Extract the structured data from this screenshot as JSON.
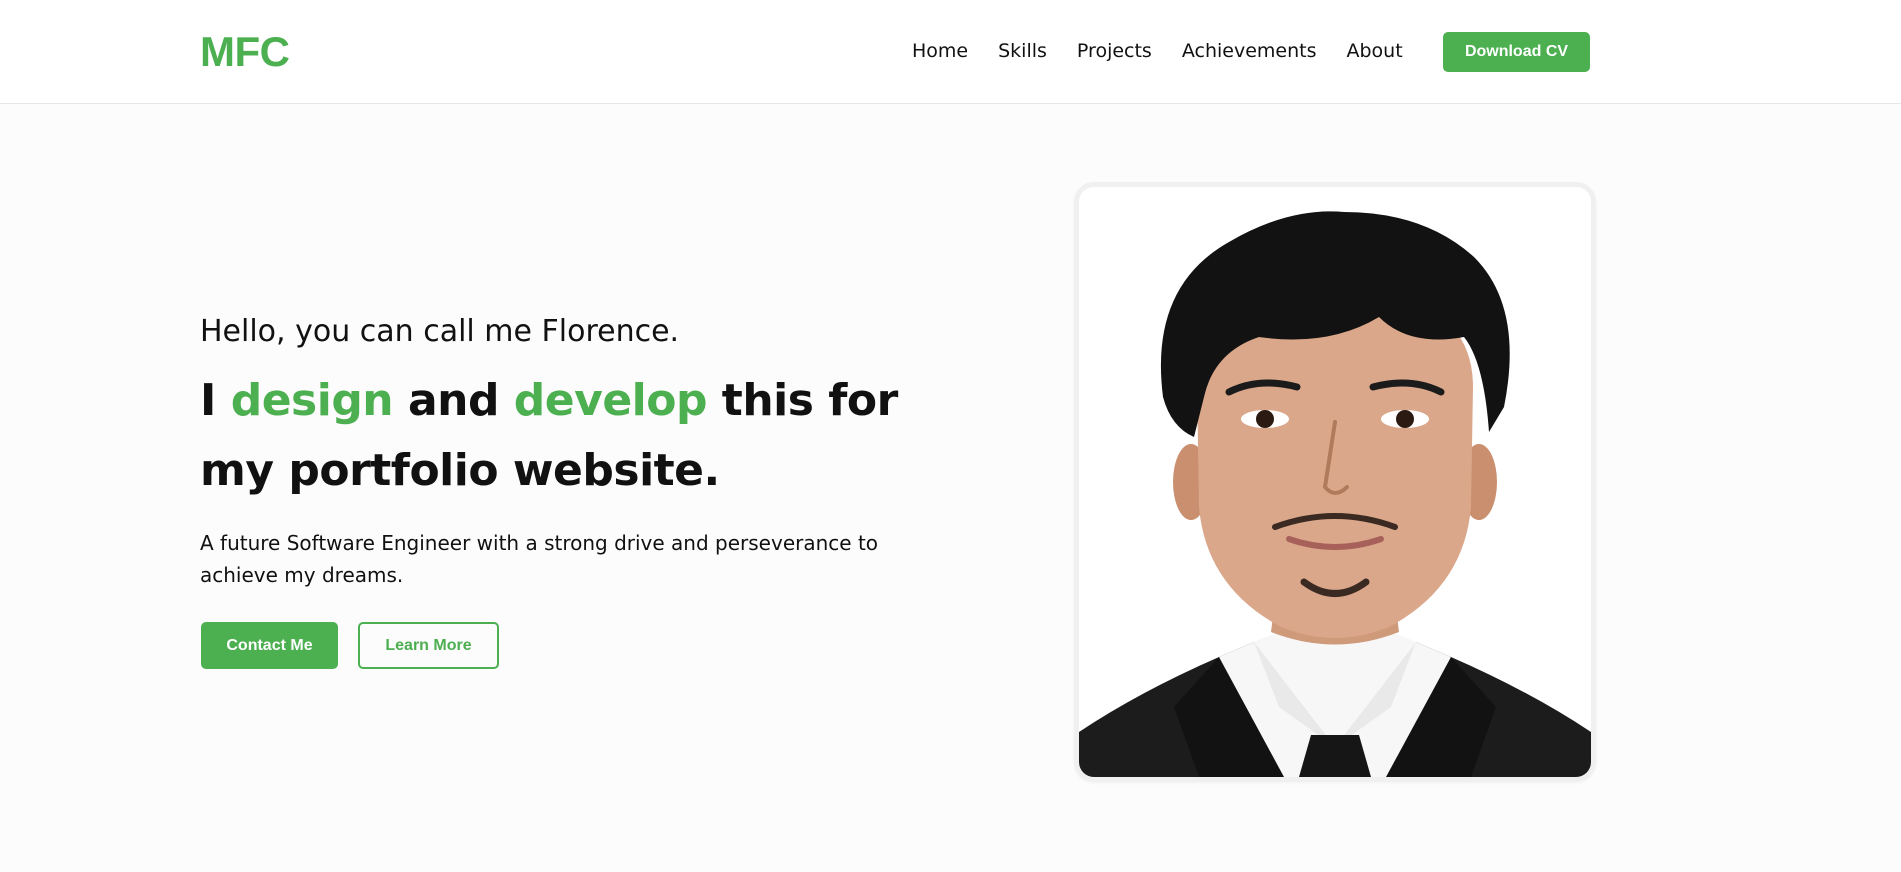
{
  "nav": {
    "logo": "MFC",
    "links": [
      "Home",
      "Skills",
      "Projects",
      "Achievements",
      "About"
    ],
    "cv_button": "Download CV"
  },
  "hero": {
    "greeting": "Hello, you can call me Florence.",
    "headline": {
      "part1": "I ",
      "accent1": "design",
      "part2": " and ",
      "accent2": "develop",
      "part3": " this for my portfolio website."
    },
    "tagline": "A future Software Engineer with a strong drive and perseverance to achieve my dreams.",
    "contact_button": "Contact Me",
    "learn_button": "Learn More"
  },
  "colors": {
    "accent": "#4caf50",
    "text": "#111111",
    "background": "#fcfcfc",
    "navbar": "#ffffff"
  }
}
